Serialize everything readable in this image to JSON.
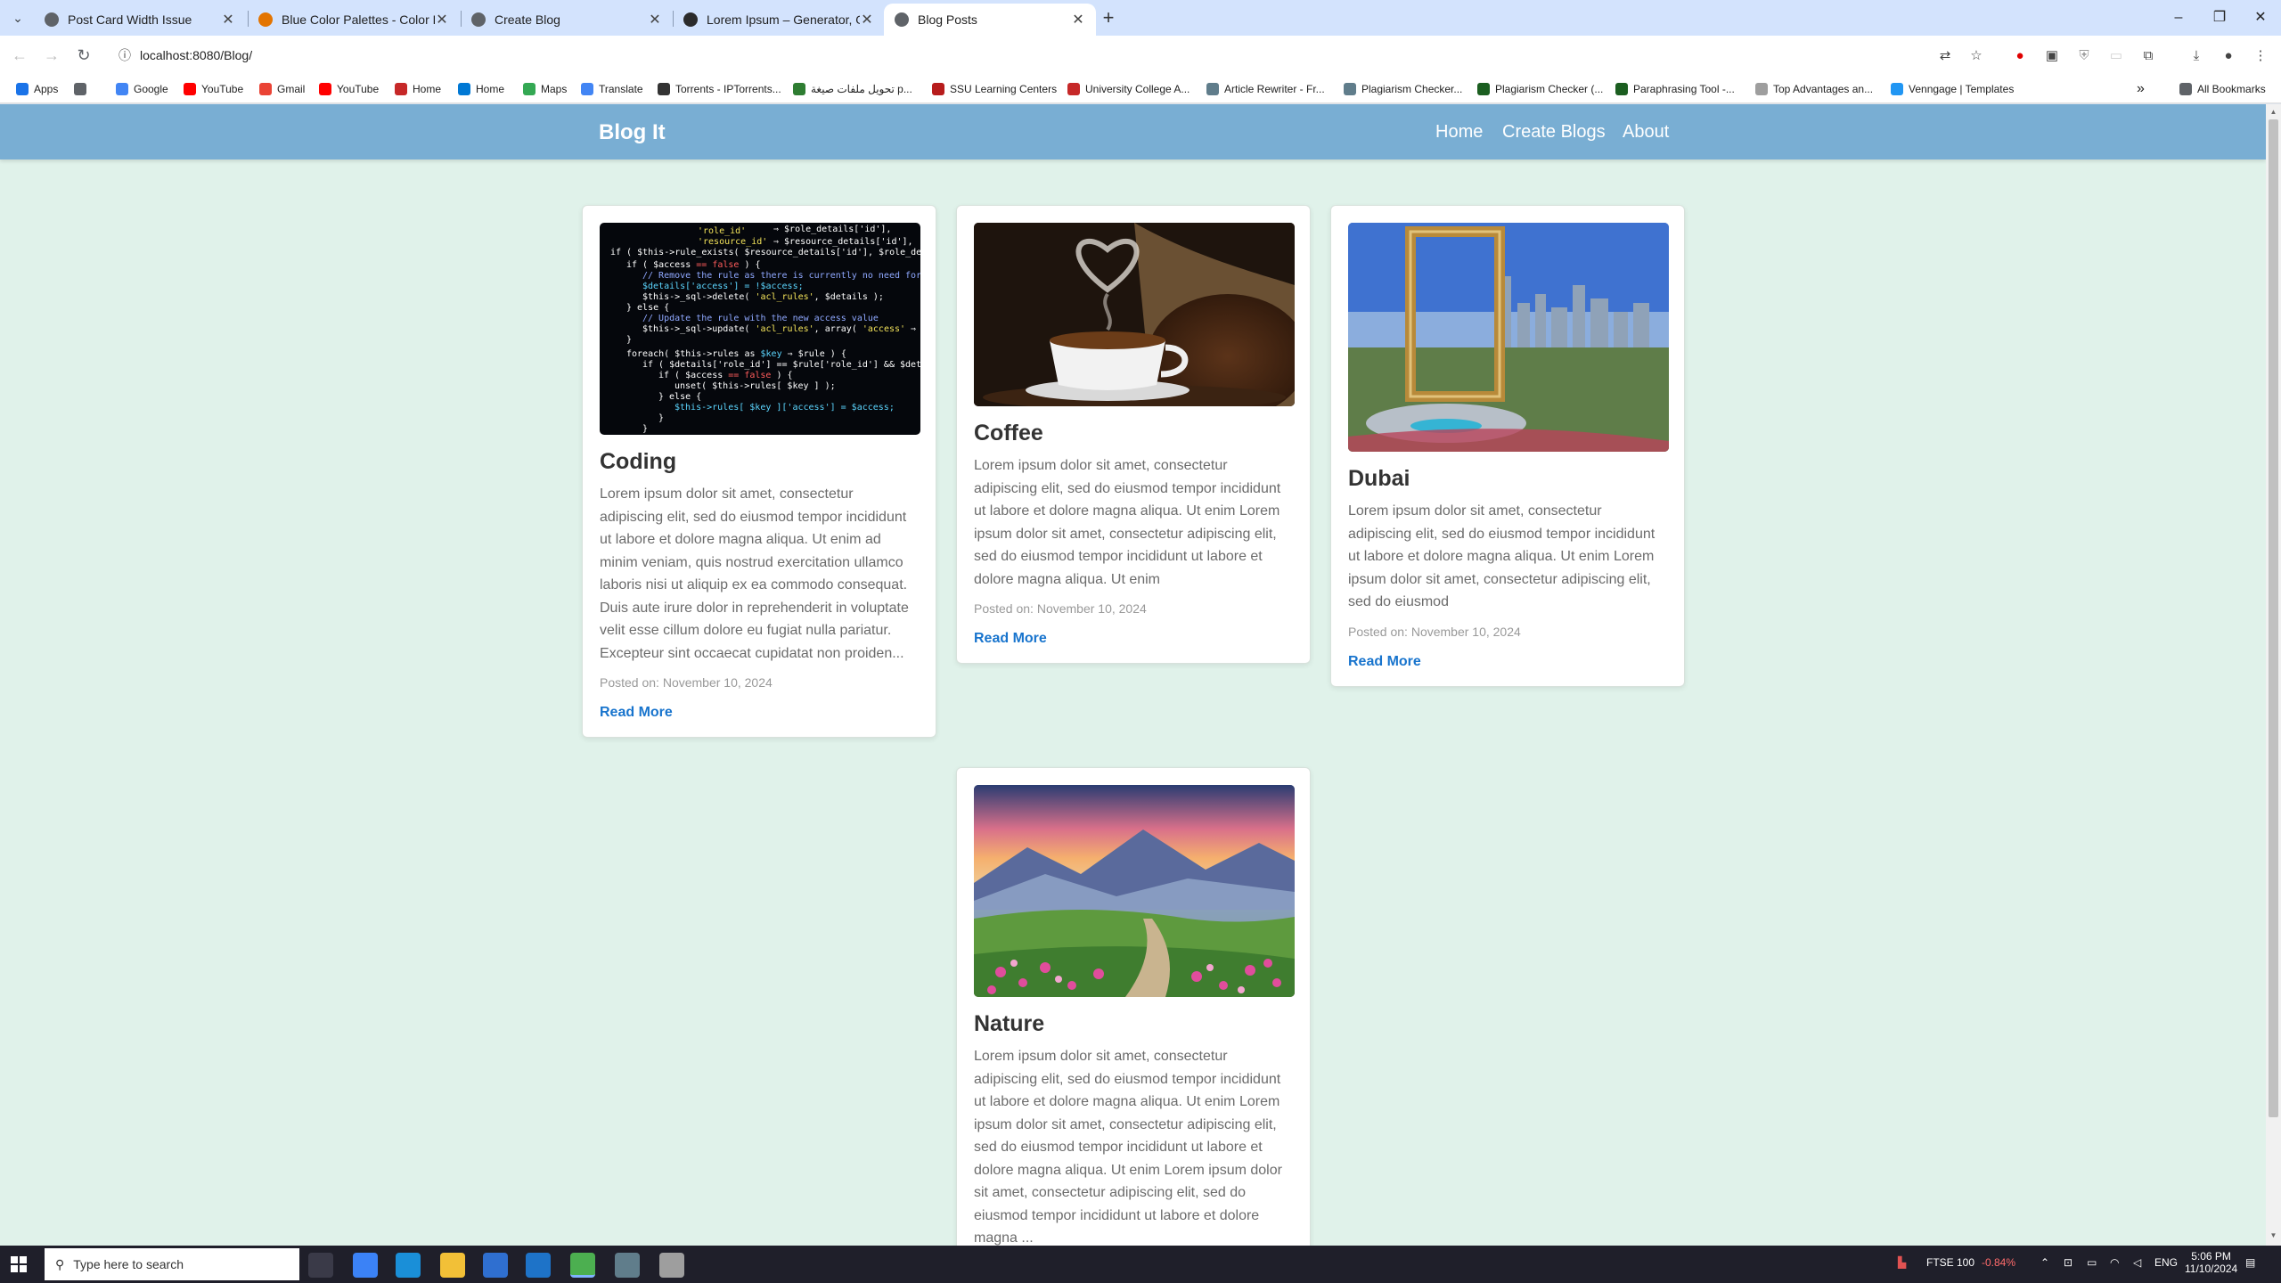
{
  "browser": {
    "tabs": [
      {
        "title": "Post Card Width Issue",
        "color": "#5f6368"
      },
      {
        "title": "Blue Color Palettes - Color Hun",
        "color": "#e37400"
      },
      {
        "title": "Create Blog",
        "color": "#5f6368"
      },
      {
        "title": "Lorem Ipsum – Generator, Orig",
        "color": "#2b2b2b"
      },
      {
        "title": "Blog Posts",
        "color": "#5f6368"
      }
    ],
    "url": "localhost:8080/Blog/",
    "bookmarks": [
      {
        "label": "Apps",
        "color": "#1a73e8"
      },
      {
        "label": "",
        "color": "#5f6368"
      },
      {
        "label": "Google",
        "color": "#4285f4"
      },
      {
        "label": "YouTube",
        "color": "#ff0000"
      },
      {
        "label": "Gmail",
        "color": "#ea4335"
      },
      {
        "label": "YouTube",
        "color": "#ff0000"
      },
      {
        "label": "Home",
        "color": "#c62828"
      },
      {
        "label": "Home",
        "color": "#0078d4"
      },
      {
        "label": "Maps",
        "color": "#34a853"
      },
      {
        "label": "Translate",
        "color": "#4285f4"
      },
      {
        "label": "Torrents - IPTorrents...",
        "color": "#333333"
      },
      {
        "label": "تحويل ملفات صيغة p...",
        "color": "#2e7d32"
      },
      {
        "label": "SSU Learning Centers",
        "color": "#b71c1c"
      },
      {
        "label": "University College A...",
        "color": "#c62828"
      },
      {
        "label": "Article Rewriter - Fr...",
        "color": "#607d8b"
      },
      {
        "label": "Plagiarism Checker...",
        "color": "#607d8b"
      },
      {
        "label": "Plagiarism Checker (...",
        "color": "#1b5e20"
      },
      {
        "label": "Paraphrasing Tool -...",
        "color": "#1b5e20"
      },
      {
        "label": "Top Advantages an...",
        "color": "#9e9e9e"
      },
      {
        "label": "Venngage | Templates",
        "color": "#2196f3"
      }
    ],
    "all_bookmarks": "All Bookmarks",
    "overflow": "»"
  },
  "site": {
    "brand": "Blog It",
    "nav": [
      "Home",
      "Create Blogs",
      "About"
    ]
  },
  "posts": [
    {
      "title": "Coding",
      "image": "code-screen-image",
      "excerpt": "Lorem ipsum dolor sit amet, consectetur adipiscing elit, sed do eiusmod tempor incididunt ut labore et dolore magna aliqua. Ut enim ad minim veniam, quis nostrud exercitation ullamco laboris nisi ut aliquip ex ea commodo consequat. Duis aute irure dolor in reprehenderit in voluptate velit esse cillum dolore eu fugiat nulla pariatur. Excepteur sint occaecat cupidatat non proiden...",
      "date": "Posted on: November 10, 2024",
      "read_more": "Read More"
    },
    {
      "title": "Coffee",
      "image": "coffee-cup-image",
      "excerpt": "Lorem ipsum dolor sit amet, consectetur adipiscing elit, sed do eiusmod tempor incididunt ut labore et dolore magna aliqua. Ut enim Lorem ipsum dolor sit amet, consectetur adipiscing elit, sed do eiusmod tempor incididunt ut labore et dolore magna aliqua. Ut enim",
      "date": "Posted on: November 10, 2024",
      "read_more": "Read More"
    },
    {
      "title": "Dubai",
      "image": "dubai-frame-image",
      "excerpt": "Lorem ipsum dolor sit amet, consectetur adipiscing elit, sed do eiusmod tempor incididunt ut labore et dolore magna aliqua. Ut enim Lorem ipsum dolor sit amet, consectetur adipiscing elit, sed do eiusmod",
      "date": "Posted on: November 10, 2024",
      "read_more": "Read More"
    },
    {
      "title": "Nature",
      "image": "mountain-meadow-image",
      "excerpt": "Lorem ipsum dolor sit amet, consectetur adipiscing elit, sed do eiusmod tempor incididunt ut labore et dolore magna aliqua. Ut enim Lorem ipsum dolor sit amet, consectetur adipiscing elit, sed do eiusmod tempor incididunt ut labore et dolore magna aliqua. Ut enim Lorem ipsum dolor sit amet, consectetur adipiscing elit, sed do eiusmod tempor incididunt ut labore et dolore magna ...",
      "date": "",
      "read_more": ""
    }
  ],
  "taskbar": {
    "search_placeholder": "Type here to search",
    "ticker_name": "FTSE 100",
    "ticker_change": "-0.84%",
    "language": "ENG",
    "time": "5:06 PM",
    "date": "11/10/2024"
  },
  "colors": {
    "navbar": "#79aed3",
    "page_background": "#e0f2ea",
    "link": "#1874cd"
  }
}
